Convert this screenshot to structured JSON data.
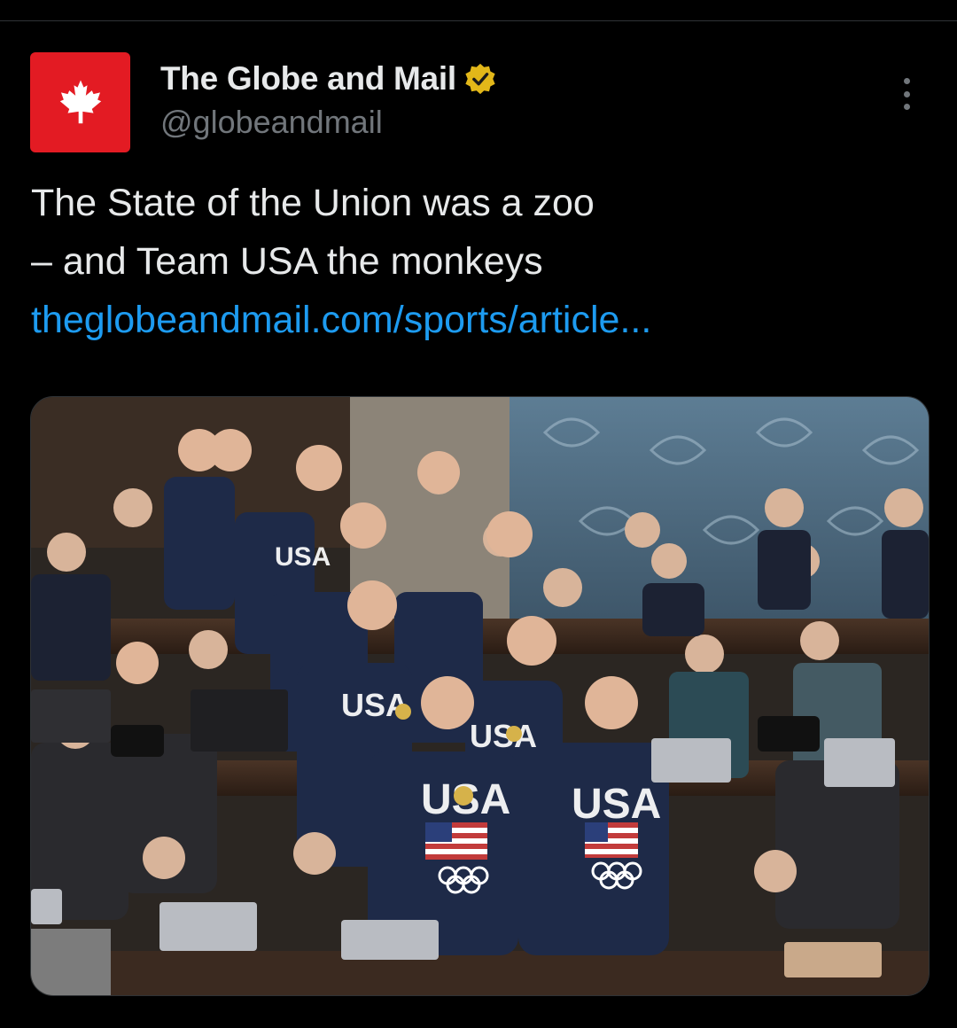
{
  "post": {
    "author": {
      "name": "The Globe and Mail",
      "handle": "@globeandmail",
      "verified": true,
      "avatar_icon": "maple-leaf-icon",
      "avatar_color": "#e31b23",
      "verified_color": "#e2b719"
    },
    "text_line1": "The State of the Union was a zoo",
    "text_line2": "– and Team USA the monkeys",
    "link": "theglobeandmail.com/sports/article...",
    "link_color": "#1d9bf0",
    "media": {
      "type": "photo",
      "sweater_text": "USA"
    }
  },
  "icons": {
    "more": "more-vertical-icon",
    "verified": "verified-badge-icon"
  }
}
